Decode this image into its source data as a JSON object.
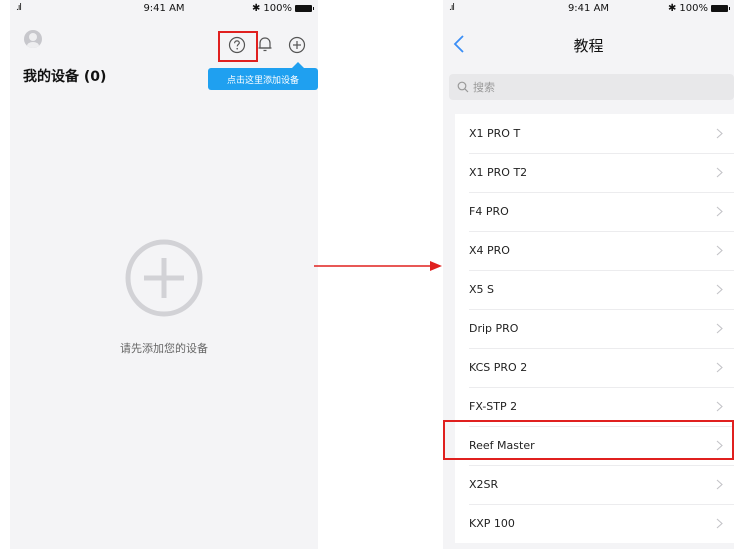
{
  "colors": {
    "accent": "#1fa0f0",
    "highlight": "#e0201f",
    "tint": "#3a8ef6"
  },
  "left_screen": {
    "status": {
      "signal": ".ıl",
      "time": "9:41 AM",
      "bluetooth": "✱",
      "battery": "100%"
    },
    "icons": [
      "avatar-icon",
      "help-icon",
      "message-icon",
      "add-icon"
    ],
    "title": "我的设备 (0)",
    "tooltip": "点击这里添加设备",
    "empty_text": "请先添加您的设备"
  },
  "right_screen": {
    "status": {
      "signal": ".ıl",
      "time": "9:41 AM",
      "bluetooth": "✱",
      "battery": "100%"
    },
    "title": "教程",
    "search_placeholder": "搜索",
    "items": [
      {
        "label": "X1 PRO T"
      },
      {
        "label": "X1 PRO T2"
      },
      {
        "label": "F4 PRO"
      },
      {
        "label": "X4 PRO"
      },
      {
        "label": "X5 S"
      },
      {
        "label": "Drip PRO"
      },
      {
        "label": "KCS PRO 2"
      },
      {
        "label": "FX-STP 2"
      },
      {
        "label": "Reef Master"
      },
      {
        "label": "X2SR"
      },
      {
        "label": "KXP 100"
      }
    ]
  }
}
